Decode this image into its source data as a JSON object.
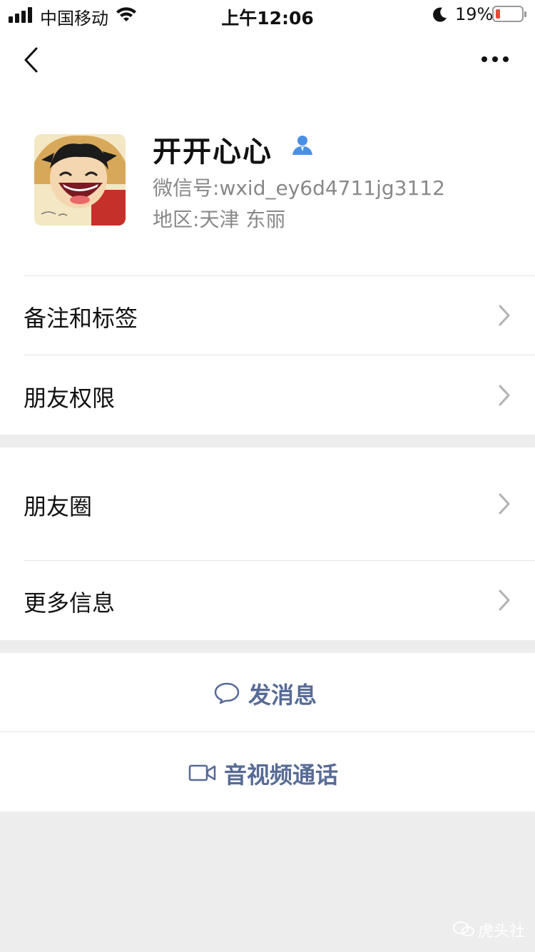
{
  "status_bar": {
    "carrier": "中国移动",
    "time": "上午12:06",
    "battery": "19%"
  },
  "profile": {
    "nickname": "开开心心",
    "wxid_label": "微信号:",
    "wxid": "wxid_ey6d4711jg3112",
    "region_label": "地区:",
    "region": "天津 东丽"
  },
  "menu": {
    "remarks": "备注和标签",
    "permissions": "朋友权限",
    "moments": "朋友圈",
    "more_info": "更多信息"
  },
  "actions": {
    "send_message": "发消息",
    "video_call": "音视频通话"
  },
  "watermark": "虎头社",
  "colors": {
    "accent_link": "#576b95",
    "battery_low": "#e84a3a",
    "page_bg": "#ededed"
  }
}
